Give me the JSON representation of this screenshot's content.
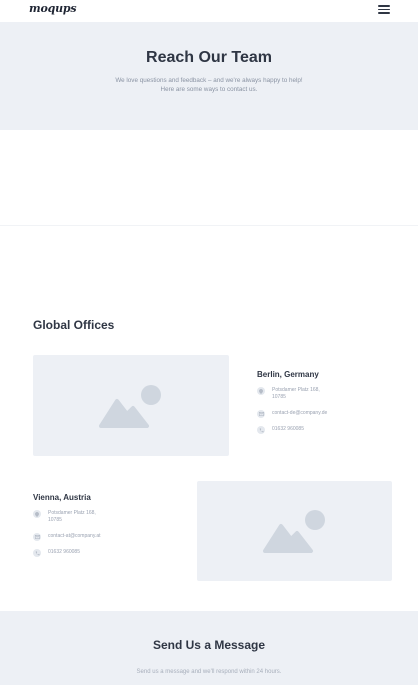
{
  "header": {
    "logo_text": "moqups",
    "menu_icon": "hamburger-icon"
  },
  "hero": {
    "title": "Reach Our Team",
    "subtitle_line1": "We love questions and feedback – and we're always happy to help!",
    "subtitle_line2": "Here are some ways to contact us."
  },
  "offices": {
    "title": "Global Offices",
    "items": [
      {
        "name": "Berlin, Germany",
        "address_line1": "Potsdamer Platz 168,",
        "address_line2": "10785",
        "email": "contact-de@company.de",
        "phone": "01632 960085"
      },
      {
        "name": "Vienna, Austria",
        "address_line1": "Potsdamer Platz 168,",
        "address_line2": "10785",
        "email": "contact-at@company.at",
        "phone": "01632 960085"
      }
    ]
  },
  "message": {
    "title": "Send Us a Message",
    "subtitle": "Send us a message and we'll respond within 24 hours."
  },
  "colors": {
    "section_bg": "#edf0f5",
    "heading": "#2f3644",
    "muted_text": "#8a93a3",
    "placeholder_icon": "#cfd6df"
  }
}
